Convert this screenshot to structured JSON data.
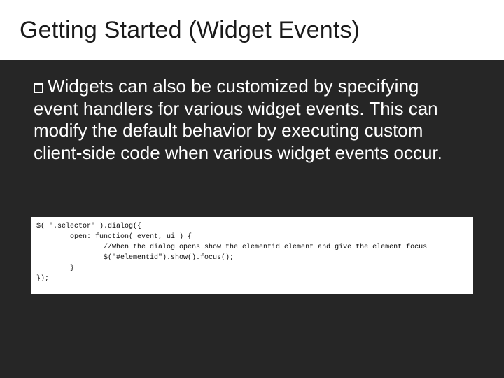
{
  "slide": {
    "title": "Getting Started (Widget Events)",
    "body_lead": "Widgets",
    "body_rest": " can also be customized by specifying event handlers for various widget events.  This can modify the default behavior by executing custom client-side code when various widget events occur.",
    "code": "$( \".selector\" ).dialog({\n        open: function( event, ui ) {\n                //When the dialog opens show the elementid element and give the element focus\n                $(\"#elementid\").show().focus();\n        }\n});"
  }
}
